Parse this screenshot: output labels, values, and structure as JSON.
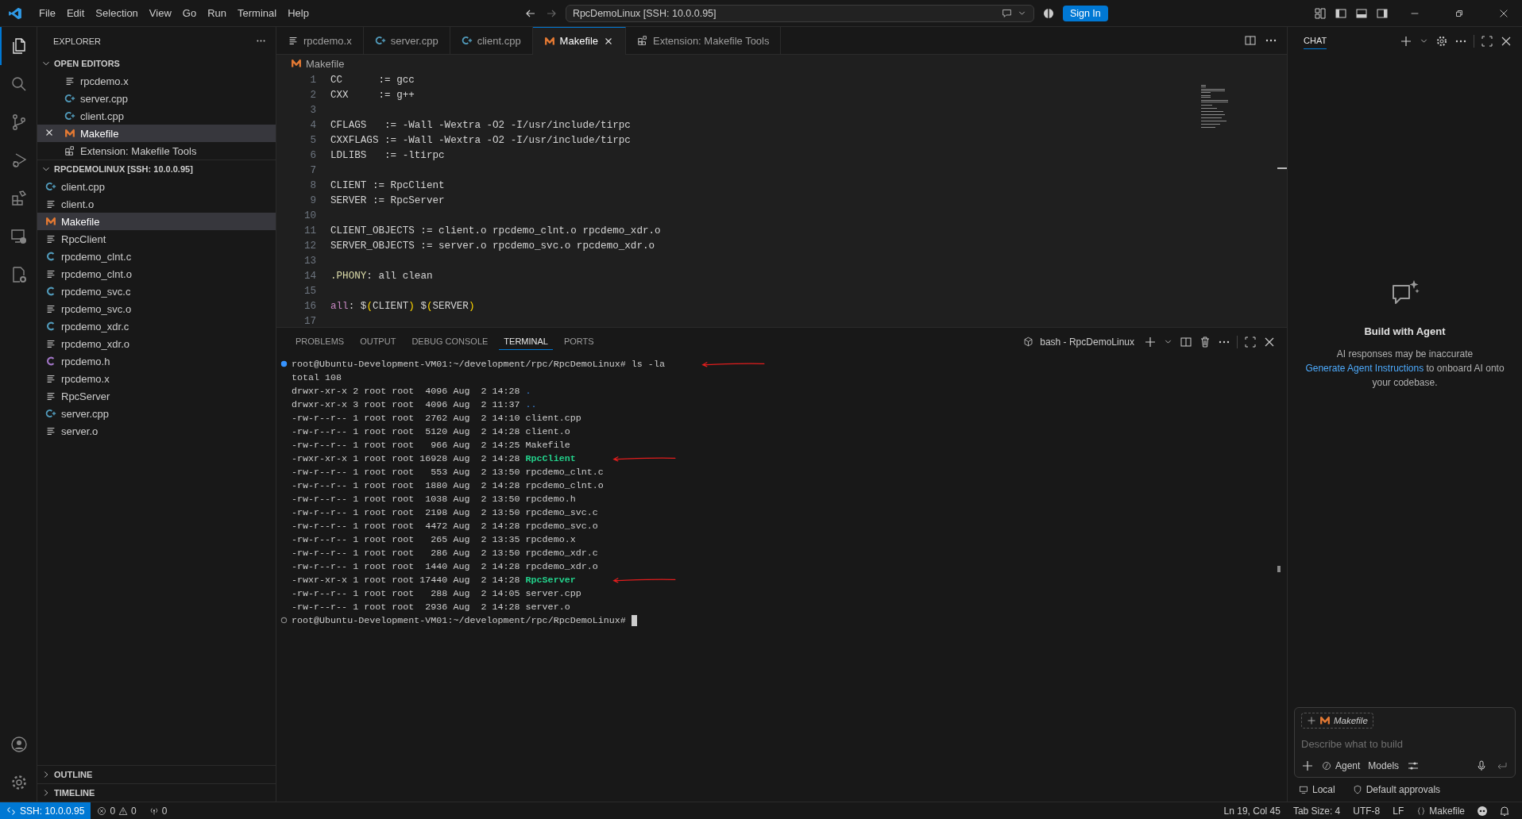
{
  "title_bar": {
    "menu": [
      "File",
      "Edit",
      "Selection",
      "View",
      "Go",
      "Run",
      "Terminal",
      "Help"
    ],
    "command_center": "RpcDemoLinux [SSH: 10.0.0.95]",
    "sign_in": "Sign In"
  },
  "activity_bar": [
    {
      "kind": "explorer",
      "selected": true
    },
    {
      "kind": "search",
      "selected": false
    },
    {
      "kind": "source-control",
      "selected": false
    },
    {
      "kind": "run-debug",
      "selected": false
    },
    {
      "kind": "extensions",
      "selected": false
    },
    {
      "kind": "remote",
      "selected": false
    },
    {
      "kind": "cpp-tools",
      "selected": false
    }
  ],
  "sidebar": {
    "title": "EXPLORER",
    "open_editors": {
      "title": "OPEN EDITORS",
      "expanded": true,
      "items": [
        {
          "name": "rpcdemo.x",
          "kind": "text",
          "selected": false
        },
        {
          "name": "server.cpp",
          "kind": "cpp",
          "selected": false
        },
        {
          "name": "client.cpp",
          "kind": "cpp",
          "selected": false
        },
        {
          "name": "Makefile",
          "kind": "make",
          "selected": true
        },
        {
          "name": "Extension: Makefile Tools",
          "kind": "ext",
          "selected": false
        }
      ]
    },
    "workspace": {
      "title": "RPCDEMOLINUX [SSH: 10.0.0.95]",
      "expanded": true,
      "items": [
        {
          "name": "client.cpp",
          "kind": "cpp",
          "selected": false
        },
        {
          "name": "client.o",
          "kind": "text",
          "selected": false
        },
        {
          "name": "Makefile",
          "kind": "make",
          "selected": true
        },
        {
          "name": "RpcClient",
          "kind": "text",
          "selected": false
        },
        {
          "name": "rpcdemo_clnt.c",
          "kind": "c",
          "selected": false
        },
        {
          "name": "rpcdemo_clnt.o",
          "kind": "text",
          "selected": false
        },
        {
          "name": "rpcdemo_svc.c",
          "kind": "c",
          "selected": false
        },
        {
          "name": "rpcdemo_svc.o",
          "kind": "text",
          "selected": false
        },
        {
          "name": "rpcdemo_xdr.c",
          "kind": "c",
          "selected": false
        },
        {
          "name": "rpcdemo_xdr.o",
          "kind": "text",
          "selected": false
        },
        {
          "name": "rpcdemo.h",
          "kind": "h",
          "selected": false
        },
        {
          "name": "rpcdemo.x",
          "kind": "text",
          "selected": false
        },
        {
          "name": "RpcServer",
          "kind": "text",
          "selected": false
        },
        {
          "name": "server.cpp",
          "kind": "cpp",
          "selected": false
        },
        {
          "name": "server.o",
          "kind": "text",
          "selected": false
        }
      ]
    },
    "collapsed_sections": [
      {
        "title": "OUTLINE",
        "expanded": false
      },
      {
        "title": "TIMELINE",
        "expanded": false
      }
    ]
  },
  "tabs": [
    {
      "label": "rpcdemo.x",
      "kind": "text",
      "selected": false
    },
    {
      "label": "server.cpp",
      "kind": "cpp",
      "selected": false
    },
    {
      "label": "client.cpp",
      "kind": "cpp",
      "selected": false
    },
    {
      "label": "Makefile",
      "kind": "make",
      "selected": true
    },
    {
      "label": "Extension: Makefile Tools",
      "kind": "ext",
      "selected": false
    }
  ],
  "breadcrumb": {
    "label": "Makefile",
    "kind": "make"
  },
  "code": [
    {
      "number": "1",
      "segments": [
        {
          "text": "CC      := gcc",
          "kind": "plain"
        }
      ]
    },
    {
      "number": "2",
      "segments": [
        {
          "text": "CXX     := g++",
          "kind": "plain"
        }
      ]
    },
    {
      "number": "3"
    },
    {
      "number": "4",
      "segments": [
        {
          "text": "CFLAGS   := -Wall -Wextra -O2 -I/usr/include/tirpc",
          "kind": "plain"
        }
      ]
    },
    {
      "number": "5",
      "segments": [
        {
          "text": "CXXFLAGS := -Wall -Wextra -O2 -I/usr/include/tirpc",
          "kind": "plain"
        }
      ]
    },
    {
      "number": "6",
      "segments": [
        {
          "text": "LDLIBS   := -ltirpc",
          "kind": "plain"
        }
      ]
    },
    {
      "number": "7"
    },
    {
      "number": "8",
      "segments": [
        {
          "text": "CLIENT := RpcClient",
          "kind": "plain"
        }
      ]
    },
    {
      "number": "9",
      "segments": [
        {
          "text": "SERVER := RpcServer",
          "kind": "plain"
        }
      ]
    },
    {
      "number": "10"
    },
    {
      "number": "11",
      "segments": [
        {
          "text": "CLIENT_OBJECTS := client.o rpcdemo_clnt.o rpcdemo_xdr.o",
          "kind": "plain"
        }
      ]
    },
    {
      "number": "12",
      "segments": [
        {
          "text": "SERVER_OBJECTS := server.o rpcdemo_svc.o rpcdemo_xdr.o",
          "kind": "plain"
        }
      ]
    },
    {
      "number": "13"
    },
    {
      "number": "14",
      "segments": [
        {
          "text": ".PHONY",
          "kind": "special"
        },
        {
          "text": ": all clean",
          "kind": "plain"
        }
      ]
    },
    {
      "number": "15"
    },
    {
      "number": "16",
      "segments": [
        {
          "text": "all",
          "kind": "target"
        },
        {
          "text": ": $",
          "kind": "plain"
        },
        {
          "text": "(",
          "kind": "bracket"
        },
        {
          "text": "CLIENT",
          "kind": "plain"
        },
        {
          "text": ")",
          "kind": "bracket"
        },
        {
          "text": " $",
          "kind": "plain"
        },
        {
          "text": "(",
          "kind": "bracket"
        },
        {
          "text": "SERVER",
          "kind": "plain"
        },
        {
          "text": ")",
          "kind": "bracket"
        }
      ]
    },
    {
      "number": "17"
    }
  ],
  "panel": {
    "tabs": [
      {
        "label": "PROBLEMS",
        "selected": false
      },
      {
        "label": "OUTPUT",
        "selected": false
      },
      {
        "label": "DEBUG CONSOLE",
        "selected": false
      },
      {
        "label": "TERMINAL",
        "selected": true
      },
      {
        "label": "PORTS",
        "selected": false
      }
    ],
    "terminal_name": "bash - RpcDemoLinux",
    "terminal": [
      {
        "kind": "prompt",
        "prompt": "root@Ubuntu-Development-VM01:~/development/rpc/RpcDemoLinux#",
        "command": "ls -la",
        "arrow": true
      },
      {
        "kind": "text",
        "text": "total 108"
      },
      {
        "kind": "dir",
        "meta": "drwxr-xr-x 2 root root  4096 Aug  2 14:28",
        "name": "."
      },
      {
        "kind": "dir",
        "meta": "drwxr-xr-x 3 root root  4096 Aug  2 11:37",
        "name": ".."
      },
      {
        "kind": "file",
        "meta": "-rw-r--r-- 1 root root  2762 Aug  2 14:10",
        "name": "client.cpp"
      },
      {
        "kind": "file",
        "meta": "-rw-r--r-- 1 root root  5120 Aug  2 14:28",
        "name": "client.o"
      },
      {
        "kind": "file",
        "meta": "-rw-r--r-- 1 root root   966 Aug  2 14:25",
        "name": "Makefile"
      },
      {
        "kind": "exec",
        "meta": "-rwxr-xr-x 1 root root 16928 Aug  2 14:28",
        "name": "RpcClient",
        "arrow": true
      },
      {
        "kind": "file",
        "meta": "-rw-r--r-- 1 root root   553 Aug  2 13:50",
        "name": "rpcdemo_clnt.c"
      },
      {
        "kind": "file",
        "meta": "-rw-r--r-- 1 root root  1880 Aug  2 14:28",
        "name": "rpcdemo_clnt.o"
      },
      {
        "kind": "file",
        "meta": "-rw-r--r-- 1 root root  1038 Aug  2 13:50",
        "name": "rpcdemo.h"
      },
      {
        "kind": "file",
        "meta": "-rw-r--r-- 1 root root  2198 Aug  2 13:50",
        "name": "rpcdemo_svc.c"
      },
      {
        "kind": "file",
        "meta": "-rw-r--r-- 1 root root  4472 Aug  2 14:28",
        "name": "rpcdemo_svc.o"
      },
      {
        "kind": "file",
        "meta": "-rw-r--r-- 1 root root   265 Aug  2 13:35",
        "name": "rpcdemo.x"
      },
      {
        "kind": "file",
        "meta": "-rw-r--r-- 1 root root   286 Aug  2 13:50",
        "name": "rpcdemo_xdr.c"
      },
      {
        "kind": "file",
        "meta": "-rw-r--r-- 1 root root  1440 Aug  2 14:28",
        "name": "rpcdemo_xdr.o"
      },
      {
        "kind": "exec",
        "meta": "-rwxr-xr-x 1 root root 17440 Aug  2 14:28",
        "name": "RpcServer",
        "arrow": true
      },
      {
        "kind": "file",
        "meta": "-rw-r--r-- 1 root root   288 Aug  2 14:05",
        "name": "server.cpp"
      },
      {
        "kind": "file",
        "meta": "-rw-r--r-- 1 root root  2936 Aug  2 14:28",
        "name": "server.o"
      },
      {
        "kind": "input",
        "prompt": "root@Ubuntu-Development-VM01:~/development/rpc/RpcDemoLinux#",
        "cursor": true
      }
    ]
  },
  "chat": {
    "title": "CHAT",
    "heading": "Build with Agent",
    "note": "AI responses may be inaccurate",
    "link": "Generate Agent Instructions",
    "after_link": "to onboard AI onto your codebase.",
    "context_chip": "Makefile",
    "placeholder": "Describe what to build",
    "mode": "Agent",
    "models": "Models",
    "footer": [
      "Local",
      "Default approvals"
    ]
  },
  "status_bar": {
    "remote": "SSH: 10.0.0.95",
    "errors": "0",
    "warnings": "0",
    "ports": "0",
    "right": [
      "Ln 19, Col 45",
      "Tab Size: 4",
      "UTF-8",
      "LF"
    ],
    "language": "Makefile"
  }
}
